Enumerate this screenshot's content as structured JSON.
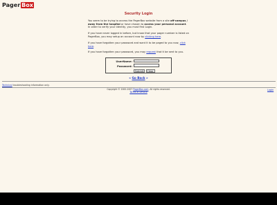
{
  "logo": {
    "text": "Pager",
    "box": "Box"
  },
  "title": "Security Login",
  "para1": {
    "t1": "You seem to be trying to access the PagerBox website from a site ",
    "b1": "off-campus / away from the hospital",
    "t2": " or have chosen to ",
    "b2": "access your personal account",
    "t3": ". In order to verify your identity, you must first Login."
  },
  "para2": {
    "t1": "If you have never logged in before, but know that your pager number is listed on PagerBox, you may setup an account now by ",
    "link": "clicking here",
    "t2": "."
  },
  "para3": {
    "t1": "If you have forgotten your password and want it to be paged to you now, ",
    "link": "click here",
    "t2": "."
  },
  "para4": {
    "t1": "If you have forgotten your password, you may ",
    "link": "request",
    "t2": " that it be sent to you."
  },
  "form": {
    "username_label": "UserName:",
    "password_label": "Password:",
    "submit_label": "Submit",
    "clear_label": "Clear",
    "username_value": "",
    "password_value": ""
  },
  "goback": {
    "left": "«",
    "label": "Go Back",
    "right": "»"
  },
  "troubleshoot": {
    "link": "Technical",
    "text": " troubleshooting information only."
  },
  "copyright": {
    "t1": "Copyright © 2000-2007 ",
    "link": "PagerBox.com",
    "t2": ". All rights reserved.",
    "terms": "Terms of Service"
  },
  "login_link": "Login"
}
